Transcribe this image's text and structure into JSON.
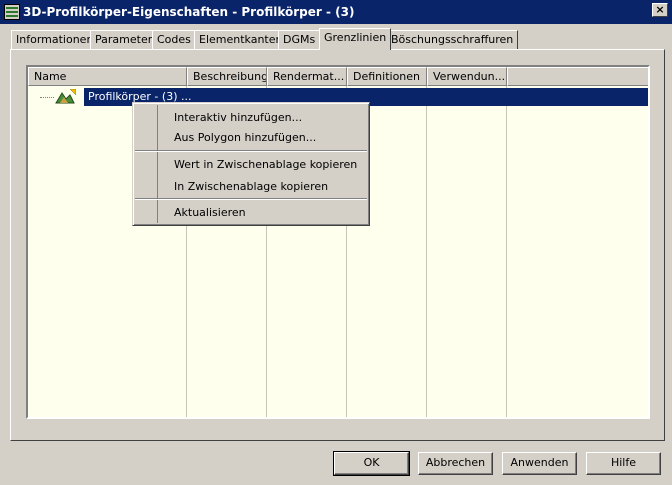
{
  "window": {
    "title": "3D-Profilkörper-Eigenschaften - Profilkörper - (3)",
    "close_label": "×",
    "icon": "dialog-app-icon"
  },
  "tabs": [
    {
      "label": "Informationen"
    },
    {
      "label": "Parameter"
    },
    {
      "label": "Codes"
    },
    {
      "label": "Elementkanten"
    },
    {
      "label": "DGMs"
    },
    {
      "label": "Grenzlinien",
      "active": true
    },
    {
      "label": "Böschungsschraffuren"
    }
  ],
  "table": {
    "columns": [
      "Name",
      "Beschreibung",
      "Rendermat...",
      "Definitionen",
      "Verwendun..."
    ],
    "rows": [
      {
        "name": "Profilkörper - (3) ...",
        "icon": "corridor-icon",
        "selected": true
      }
    ]
  },
  "context_menu": {
    "groups": [
      [
        "Interaktiv hinzufügen...",
        "Aus Polygon hinzufügen..."
      ],
      [
        "Wert in Zwischenablage kopieren",
        "In Zwischenablage kopieren"
      ],
      [
        "Aktualisieren"
      ]
    ]
  },
  "buttons": {
    "ok": "OK",
    "cancel": "Abbrechen",
    "apply": "Anwenden",
    "help": "Hilfe"
  },
  "colors": {
    "title_bar": "#0a246a",
    "dialog_bg": "#d4d0c8",
    "list_bg": "#ffffee",
    "selection": "#0a246a"
  }
}
